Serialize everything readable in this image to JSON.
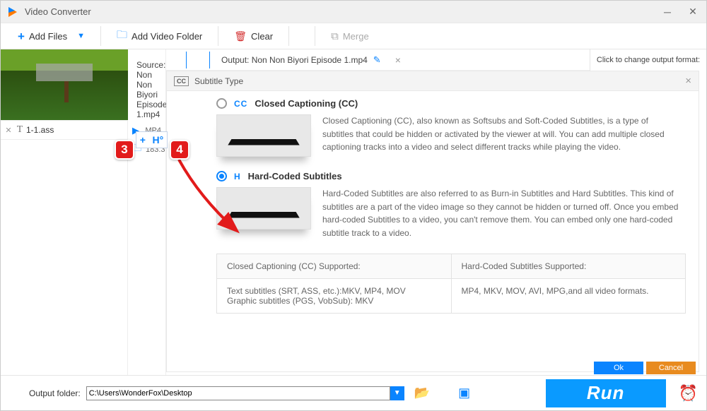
{
  "window": {
    "title": "Video Converter"
  },
  "toolbar": {
    "add_files": "Add Files",
    "add_folder": "Add Video Folder",
    "clear": "Clear",
    "merge": "Merge"
  },
  "source": {
    "label_prefix": "Source: ",
    "file": "Non Non Biyori Episode 1.mp4"
  },
  "output": {
    "label_prefix": "Output: ",
    "file": "Non Non Biyori Episode 1.mp4"
  },
  "format_button": "Click to change output format:",
  "meta": {
    "format": "MP4",
    "size": "183.3"
  },
  "subtitle_file": "1-1.ass",
  "panel": {
    "title": "Subtitle Type",
    "cc": {
      "label": "Closed Captioning (CC)",
      "tag": "CC",
      "desc": "Closed Captioning (CC), also known as Softsubs and Soft-Coded Subtitles, is a type of subtitles that could be hidden or activated by the viewer at will. You can add multiple closed captioning tracks into a video and select different tracks while playing the video."
    },
    "hard": {
      "label": "Hard-Coded Subtitles",
      "tag": "H",
      "desc": "Hard-Coded Subtitles are also referred to as Burn-in Subtitles and Hard Subtitles. This kind of subtitles are a part of the video image so they cannot be hidden or turned off. Once you embed hard-coded Subtitles to a video, you can't remove them. You can embed only one hard-coded subtitle track to a video."
    },
    "table": {
      "cc_head": "Closed Captioning (CC) Supported:",
      "hard_head": "Hard-Coded Subtitles Supported:",
      "cc_body": "Text subtitles (SRT, ASS, etc.):MKV, MP4, MOV\nGraphic subtitles (PGS, VobSub): MKV",
      "hard_body": "MP4, MKV, MOV, AVI, MPG,and all video formats."
    }
  },
  "callouts": {
    "three": "3",
    "four": "4"
  },
  "dialog": {
    "ok": "Ok",
    "cancel": "Cancel"
  },
  "bottom": {
    "output_label": "Output folder:",
    "output_path": "C:\\Users\\WonderFox\\Desktop",
    "run": "Run"
  }
}
